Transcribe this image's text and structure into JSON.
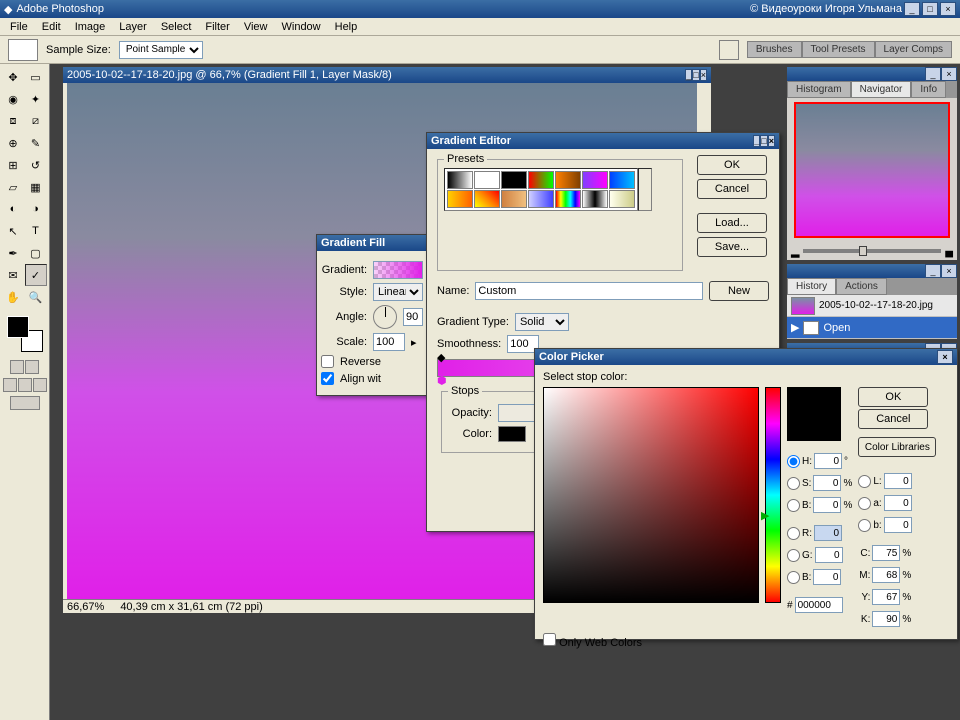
{
  "app": {
    "title": "Adobe Photoshop",
    "watermark": "© Видеоуроки Игоря Ульмана"
  },
  "menu": [
    "File",
    "Edit",
    "Image",
    "Layer",
    "Select",
    "Filter",
    "View",
    "Window",
    "Help"
  ],
  "options": {
    "sample_size_label": "Sample Size:",
    "sample_size_value": "Point Sample"
  },
  "right_tabs": [
    "Brushes",
    "Tool Presets",
    "Layer Comps"
  ],
  "doc": {
    "title": "2005-10-02--17-18-20.jpg @ 66,7% (Gradient Fill 1, Layer Mask/8)",
    "zoom": "66,67%",
    "dims": "40,39 cm x 31,61 cm (72 ppi)"
  },
  "navigator": {
    "tabs": [
      "Histogram",
      "Navigator",
      "Info"
    ]
  },
  "history": {
    "tabs": [
      "History",
      "Actions"
    ],
    "snapshot": "2005-10-02--17-18-20.jpg",
    "items": [
      "Open"
    ]
  },
  "gradfill": {
    "title": "Gradient Fill",
    "labels": {
      "gradient": "Gradient:",
      "style": "Style:",
      "angle": "Angle:",
      "scale": "Scale:"
    },
    "style": "Linear",
    "angle": "90",
    "scale": "100",
    "reverse": "Reverse",
    "align": "Align wit",
    "reverse_checked": false,
    "align_checked": true
  },
  "gradedit": {
    "title": "Gradient Editor",
    "presets_label": "Presets",
    "buttons": {
      "ok": "OK",
      "cancel": "Cancel",
      "load": "Load...",
      "save": "Save...",
      "new": "New"
    },
    "name_label": "Name:",
    "name_value": "Custom",
    "type_label": "Gradient Type:",
    "type_value": "Solid",
    "smooth_label": "Smoothness:",
    "smooth_value": "100",
    "stops_label": "Stops",
    "opacity_label": "Opacity:",
    "color_label": "Color:",
    "preset_colors": [
      "linear-gradient(to right,#000,#fff)",
      "linear-gradient(to right,#fff,#fff)",
      "linear-gradient(to right,#000,#000)",
      "linear-gradient(to right,#f00,#0f0)",
      "linear-gradient(to right,#ff8000,#804000)",
      "linear-gradient(to right,#8040ff,#ff00ff)",
      "linear-gradient(to right,#0040ff,#00c0ff)",
      "linear-gradient(to right,#ffd000,#ff6000)",
      "linear-gradient(45deg,#ff0,#f80,#f00)",
      "linear-gradient(to right,#d08040,#f0c080)",
      "linear-gradient(to right,#d0d0ff,#4040ff)",
      "linear-gradient(to right,#f00,#ff0,#0f0,#0ff,#00f,#f0f)",
      "linear-gradient(to right,#fff,#000,#fff)",
      "linear-gradient(to right,#ffe,#cc8)"
    ]
  },
  "colorpicker": {
    "title": "Color Picker",
    "subtitle": "Select stop color:",
    "buttons": {
      "ok": "OK",
      "cancel": "Cancel",
      "libs": "Color Libraries"
    },
    "webonly": "Only Web Colors",
    "hex": "000000",
    "values": {
      "H": "0",
      "S": "0",
      "B": "0",
      "R": "0",
      "G": "0",
      "Bb": "0",
      "L": "0",
      "a": "0",
      "b": "0",
      "C": "75",
      "M": "68",
      "Y": "67",
      "K": "90"
    },
    "swatch_new": "#000000",
    "swatch_old": "#000000"
  }
}
